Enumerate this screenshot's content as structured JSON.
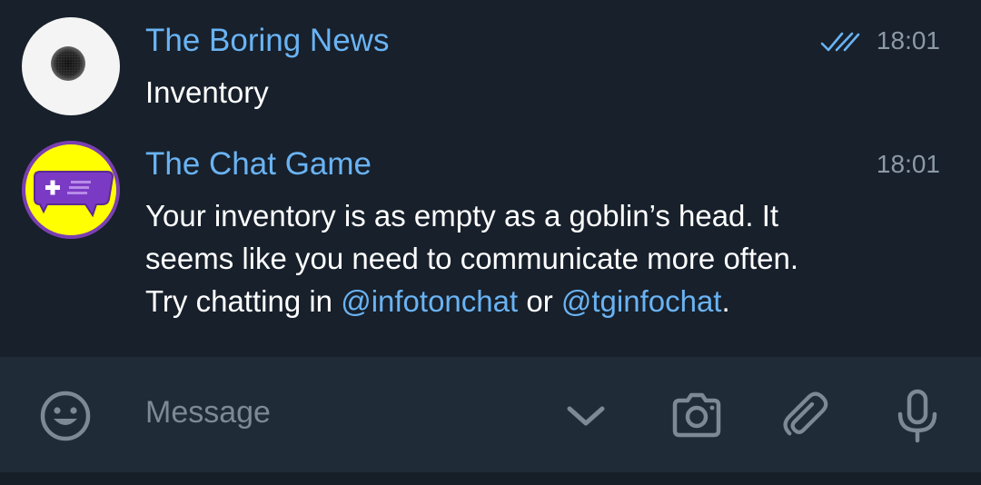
{
  "chats": [
    {
      "sender": "The Boring News",
      "time": "18:01",
      "status": "read",
      "text": "Inventory"
    },
    {
      "sender": "The Chat Game",
      "time": "18:01",
      "text_parts": {
        "line1": "Your inventory is as empty as a goblin’s head. It",
        "line2": "seems like you need to communicate more often.",
        "line3_start": "Try chatting in ",
        "mention1": "@infotonchat",
        "between": " or ",
        "mention2": "@tginfochat",
        "end": "."
      }
    }
  ],
  "input": {
    "placeholder": "Message"
  },
  "icons": {
    "emoji": "emoji-icon",
    "collapse": "chevron-down-icon",
    "camera": "camera-icon",
    "attach": "paperclip-icon",
    "voice": "microphone-icon"
  },
  "colors": {
    "background": "#17202b",
    "input_bar": "#202b38",
    "accent": "#6ab3f3",
    "text": "#ffffff",
    "muted": "#8c99a6"
  }
}
